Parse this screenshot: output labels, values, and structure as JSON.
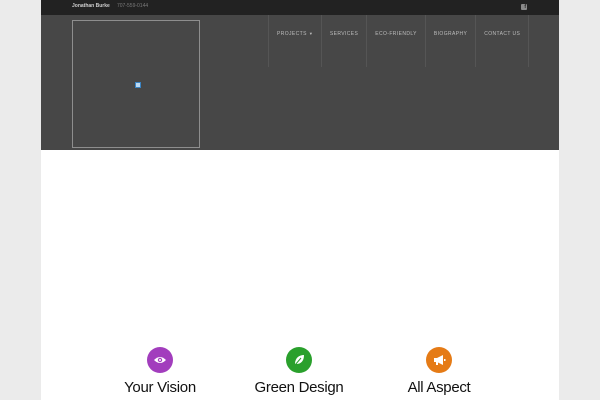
{
  "topbar": {
    "name": "Jonathan Burke",
    "phone": "707-559-0144",
    "social_icon": "facebook-icon"
  },
  "nav": {
    "items": [
      {
        "label": "Projects",
        "has_dropdown": true
      },
      {
        "label": "Services"
      },
      {
        "label": "Eco-Friendly"
      },
      {
        "label": "Biography"
      },
      {
        "label": "Contact Us"
      }
    ]
  },
  "features": [
    {
      "title": "Your Vision",
      "icon": "eye-icon",
      "color": "#a23dbd"
    },
    {
      "title": "Green Design",
      "icon": "leaf-icon",
      "color": "#2aa02c"
    },
    {
      "title": "All Aspect",
      "icon": "megaphone-icon",
      "color": "#e57b16"
    }
  ],
  "colors": {
    "topbar": "#222222",
    "header": "#474747",
    "background": "#ebebeb"
  }
}
